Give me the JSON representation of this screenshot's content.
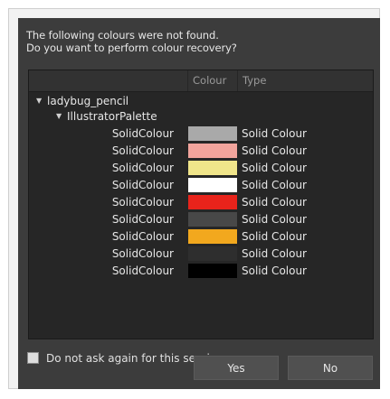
{
  "message": {
    "line1": "The following colours were not found.",
    "line2": "Do you want to perform colour recovery?"
  },
  "tree": {
    "columns": [
      "",
      "Colour",
      "Type"
    ],
    "root": "ladybug_pencil",
    "palette": "IllustratorPalette",
    "rows": [
      {
        "name": "SolidColour",
        "color": "#a9a9a9",
        "type": "Solid Colour"
      },
      {
        "name": "SolidColour",
        "color": "#f2a49c",
        "type": "Solid Colour"
      },
      {
        "name": "SolidColour",
        "color": "#f0e58a",
        "type": "Solid Colour"
      },
      {
        "name": "SolidColour",
        "color": "#ffffff",
        "type": "Solid Colour"
      },
      {
        "name": "SolidColour",
        "color": "#e8231b",
        "type": "Solid Colour"
      },
      {
        "name": "SolidColour",
        "color": "#484848",
        "type": "Solid Colour"
      },
      {
        "name": "SolidColour",
        "color": "#f2a81e",
        "type": "Solid Colour"
      },
      {
        "name": "SolidColour",
        "color": "#2e2e2e",
        "type": "Solid Colour"
      },
      {
        "name": "SolidColour",
        "color": "#000000",
        "type": "Solid Colour"
      }
    ]
  },
  "checkbox": {
    "label": "Do not ask again for this session",
    "checked": false
  },
  "buttons": {
    "yes": "Yes",
    "no": "No"
  },
  "icons": {
    "expand": "triangle-down-icon"
  }
}
